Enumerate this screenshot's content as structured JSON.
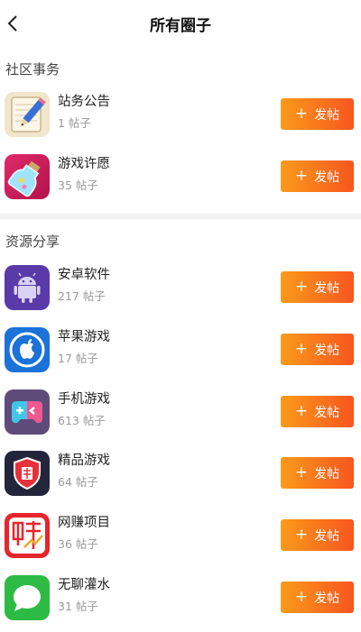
{
  "header": {
    "title": "所有圈子"
  },
  "sections": [
    {
      "title": "社区事务",
      "items": [
        {
          "name": "站务公告",
          "count": "1 帖子",
          "icon": "notepad-pencil-icon"
        },
        {
          "name": "游戏许愿",
          "count": "35 帖子",
          "icon": "wish-bottle-icon"
        }
      ]
    },
    {
      "title": "资源分享",
      "items": [
        {
          "name": "安卓软件",
          "count": "217 帖子",
          "icon": "android-icon"
        },
        {
          "name": "苹果游戏",
          "count": "17 帖子",
          "icon": "apple-icon"
        },
        {
          "name": "手机游戏",
          "count": "613 帖子",
          "icon": "gamepad-icon"
        },
        {
          "name": "精品游戏",
          "count": "64 帖子",
          "icon": "quality-shield-icon"
        },
        {
          "name": "网赚项目",
          "count": "36 帖子",
          "icon": "earn-money-icon"
        },
        {
          "name": "无聊灌水",
          "count": "31 帖子",
          "icon": "chat-bubble-icon"
        }
      ]
    }
  ],
  "post_button": {
    "plus": "+",
    "label": "发帖"
  },
  "colors": {
    "button_start": "#fb9a1a",
    "button_end": "#f7561f"
  }
}
